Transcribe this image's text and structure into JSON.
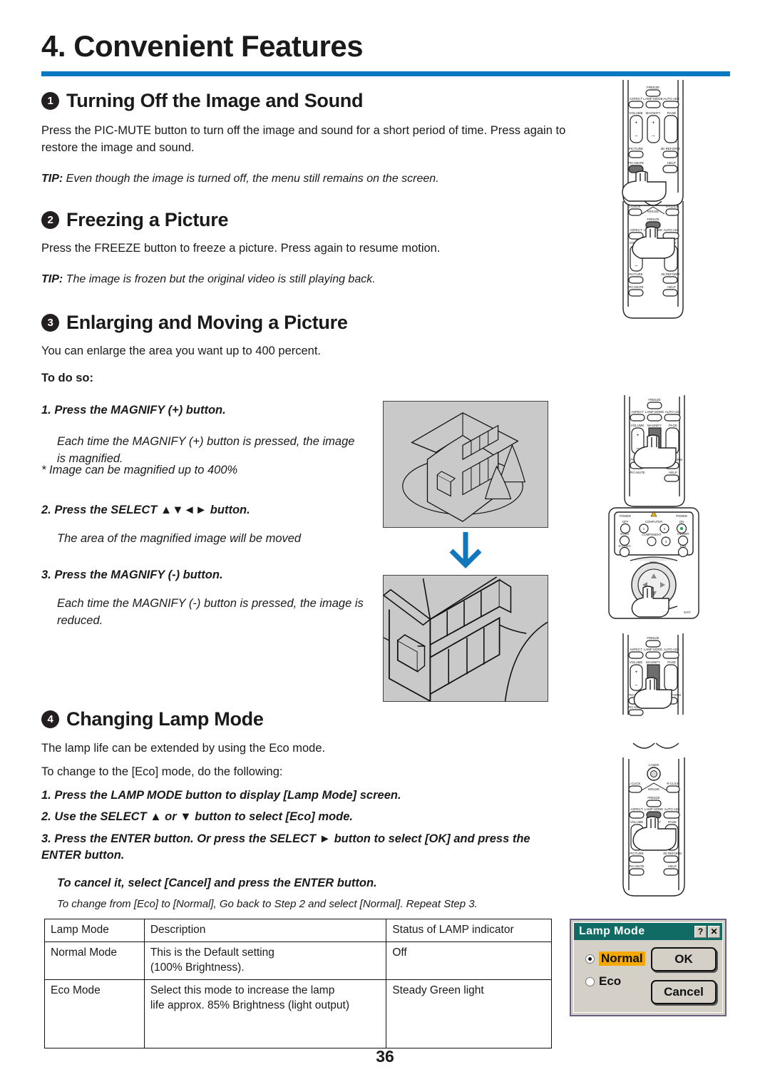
{
  "document": {
    "chapter_title": "4. Convenient Features",
    "page_number": "36"
  },
  "sections": [
    {
      "num": "1",
      "heading": "Turning Off the Image and Sound",
      "body": "Press the PIC-MUTE button to turn off the image and sound for a short period of time. Press again to restore the image and sound.",
      "tip_label": "TIP:",
      "tip_text": "Even though the image is turned off, the menu still remains on the screen."
    },
    {
      "num": "2",
      "heading": "Freezing a Picture",
      "body": "Press the FREEZE button to freeze a picture. Press again to resume motion.",
      "tip_label": "TIP:",
      "tip_text": "The image is frozen but the original video is still playing back."
    },
    {
      "num": "3",
      "heading": "Enlarging and Moving a Picture",
      "body": "You can enlarge the area you want up to 400 percent.",
      "todo_label": "To do so:",
      "steps": [
        {
          "title": "1. Press the MAGNIFY (+) button.",
          "desc": "Each time the MAGNIFY (+) button is pressed, the image is magnified.",
          "note": "* Image can be magnified up to 400%"
        },
        {
          "title": "2. Press the SELECT ▲▼◄► button.",
          "desc": "The area of the magnified image will be moved"
        },
        {
          "title": "3. Press the MAGNIFY (-) button.",
          "desc": "Each time the MAGNIFY (-) button is pressed, the image is reduced."
        }
      ]
    },
    {
      "num": "4",
      "heading": "Changing Lamp Mode",
      "body1": "The lamp life can be extended by using the Eco mode.",
      "body2": "To change to the [Eco] mode, do the following:",
      "steps": [
        "1. Press the LAMP MODE button to display [Lamp Mode] screen.",
        "2. Use the SELECT ▲ or ▼ button to select [Eco] mode.",
        "3. Press the ENTER button. Or press the SELECT ► button to select [OK] and press the ENTER button."
      ],
      "cancel_note": "To cancel it, select [Cancel] and press the ENTER button.",
      "revert_note": "To change from [Eco] to [Normal], Go back to Step 2 and select [Normal]. Repeat Step 3."
    }
  ],
  "lamp_table": {
    "headers": [
      "Lamp Mode",
      "Description",
      "Status of LAMP indicator"
    ],
    "rows": [
      {
        "mode": "Normal Mode",
        "description_line1": "This is the Default setting",
        "description_line2": "(100% Brightness).",
        "status": "Off"
      },
      {
        "mode": "Eco Mode",
        "description_line1": "Select this mode to increase the lamp",
        "description_line2": "life approx. 85% Brightness (light output)",
        "status": "Steady Green light"
      }
    ]
  },
  "lamp_dialog": {
    "title": "Lamp Mode",
    "help_icon": "?",
    "close_icon": "✕",
    "options": [
      {
        "label": "Normal",
        "selected": true
      },
      {
        "label": "Eco",
        "selected": false
      }
    ],
    "ok_label": "OK",
    "cancel_label": "Cancel",
    "titlebar_color": "#0f6b63",
    "highlight_color": "#f5a800"
  },
  "remotes": {
    "pic_mute": {
      "pressed_button": "PIC-MUTE",
      "labels": [
        "FREEZE",
        "ASPECT",
        "LAMP MODE",
        "AUTO ADJ.",
        "VOLUME",
        "MAGNIFY",
        "PAGE",
        "UP",
        "DOWN",
        "PICTURE",
        "3D REFORM",
        "PIC-MUTE",
        "HELP"
      ]
    },
    "freeze": {
      "pressed_button": "FREEZE",
      "labels": [
        "L-CLICK",
        "MOUSE",
        "R-CLICK",
        "FREEZE",
        "ASPECT",
        "LAMP MODE",
        "AUTO ADJ.",
        "VOLUME",
        "MAGNIFY",
        "PAGE",
        "UP",
        "DOWN",
        "PICTURE",
        "3D REFORM",
        "PIC-MUTE",
        "HELP"
      ]
    },
    "magnify_plus": {
      "pressed_button": "MAGNIFY +",
      "labels": [
        "FREEZE",
        "ASPECT",
        "LAMP MODE",
        "AUTO ADJ.",
        "VOLUME",
        "MAGNIFY",
        "PAGE",
        "UP",
        "DOWN",
        "PICTURE",
        "3D REFORM",
        "PIC-MUTE",
        "HELP"
      ]
    },
    "select_pad": {
      "pressed_button": "SELECT",
      "labels": [
        "POWER",
        "OFF",
        "ON",
        "COMPUTER",
        "1",
        "2",
        "VIDEO",
        "COMPONENT",
        "3",
        "VIEWER",
        "S-VIDEO",
        "LAN",
        "MENU",
        "SELECT",
        "EXIT"
      ]
    },
    "magnify_minus": {
      "pressed_button": "MAGNIFY -",
      "labels": [
        "FREEZE",
        "ASPECT",
        "LAMP MODE",
        "AUTO ADJ.",
        "VOLUME",
        "MAGNIFY",
        "PAGE",
        "UP",
        "DOWN",
        "PICTURE",
        "3D REFORM",
        "PIC-MUTE"
      ]
    },
    "lamp_mode": {
      "pressed_button": "LAMP MODE",
      "labels": [
        "LASER",
        "L-CLICK",
        "MOUSE",
        "R-CLICK",
        "FREEZE",
        "ASPECT",
        "LAMP MODE",
        "AUTO ADJ.",
        "VOLUME",
        "MAGNIFY",
        "PAGE",
        "UP",
        "DOWN",
        "PICTURE",
        "3D REFORM",
        "PIC-MUTE",
        "HELP"
      ]
    }
  }
}
